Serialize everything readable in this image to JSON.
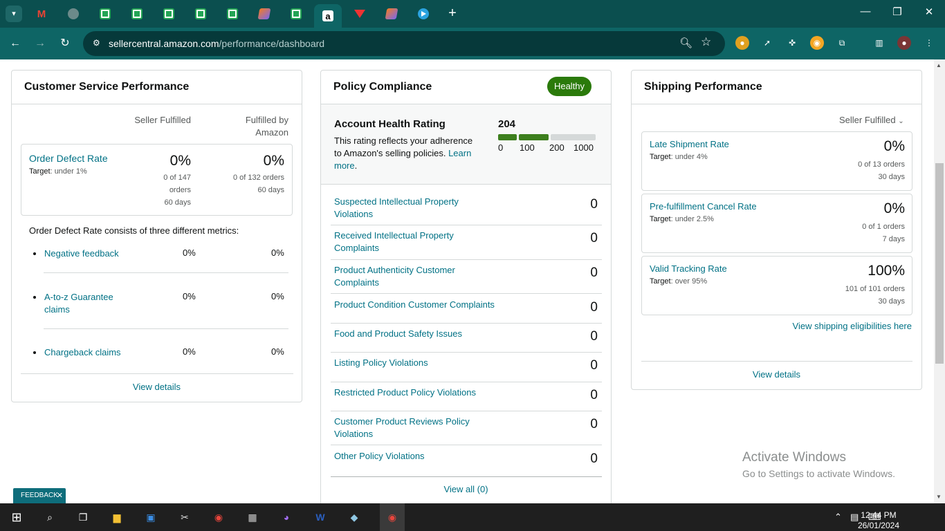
{
  "browser": {
    "url_domain": "sellercentral.amazon.com",
    "url_path": "/performance/dashboard",
    "tabs": [
      {
        "icon": "gmail-icon"
      },
      {
        "icon": "globe-icon"
      },
      {
        "icon": "sheets-icon"
      },
      {
        "icon": "sheets-icon"
      },
      {
        "icon": "sheets-icon"
      },
      {
        "icon": "sheets-icon"
      },
      {
        "icon": "sheets-icon"
      },
      {
        "icon": "clickup-icon"
      },
      {
        "icon": "sheets-icon"
      },
      {
        "icon": "amazon-icon",
        "active": true
      },
      {
        "icon": "red-icon"
      },
      {
        "icon": "clickup-icon"
      },
      {
        "icon": "telegram-icon"
      }
    ]
  },
  "csp": {
    "title": "Customer Service Performance",
    "col_seller": "Seller Fulfilled",
    "col_fba_1": "Fulfilled by",
    "col_fba_2": "Amazon",
    "odr": {
      "title": "Order Defect Rate",
      "target_label": "Target",
      "target_value": ": under 1%",
      "seller_pct": "0%",
      "seller_sub1": "0 of 147",
      "seller_sub2": "orders",
      "seller_sub3": "60 days",
      "fba_pct": "0%",
      "fba_sub1": "0 of 132 orders",
      "fba_sub2": "60 days"
    },
    "description": "Order Defect Rate consists of three different metrics:",
    "metrics": [
      {
        "name": "Negative feedback",
        "seller": "0%",
        "fba": "0%"
      },
      {
        "name": "A-to-z Guarantee claims",
        "seller": "0%",
        "fba": "0%"
      },
      {
        "name": "Chargeback claims",
        "seller": "0%",
        "fba": "0%"
      }
    ],
    "view_details": "View details"
  },
  "policy": {
    "title": "Policy Compliance",
    "badge": "Healthy",
    "ahr_title": "Account Health Rating",
    "ahr_desc": "This rating reflects your adherence to Amazon's selling policies.",
    "ahr_learn": "Learn more",
    "ahr_score": "204",
    "ahr_ticks": [
      "0",
      "100",
      "200",
      "1000"
    ],
    "rows": [
      {
        "name": "Suspected Intellectual Property Violations",
        "value": "0"
      },
      {
        "name": "Received Intellectual Property Complaints",
        "value": "0"
      },
      {
        "name": "Product Authenticity Customer Complaints",
        "value": "0"
      },
      {
        "name": "Product Condition Customer Complaints",
        "value": "0"
      },
      {
        "name": "Food and Product Safety Issues",
        "value": "0"
      },
      {
        "name": "Listing Policy Violations",
        "value": "0"
      },
      {
        "name": "Restricted Product Policy Violations",
        "value": "0"
      },
      {
        "name": "Customer Product Reviews Policy Violations",
        "value": "0"
      },
      {
        "name": "Other Policy Violations",
        "value": "0"
      }
    ],
    "view_all": "View all (0)"
  },
  "shipping": {
    "title": "Shipping Performance",
    "dropdown": "Seller Fulfilled",
    "metrics": [
      {
        "name": "Late Shipment Rate",
        "target_label": "Target",
        "target_value": ": under 4%",
        "pct": "0%",
        "sub1": "0 of 13 orders",
        "sub2": "30 days"
      },
      {
        "name": "Pre-fulfillment Cancel Rate",
        "target_label": "Target",
        "target_value": ": under 2.5%",
        "pct": "0%",
        "sub1": "0 of 1 orders",
        "sub2": "7 days"
      },
      {
        "name": "Valid Tracking Rate",
        "target_label": "Target",
        "target_value": ": over 95%",
        "pct": "100%",
        "sub1": "101 of 101 orders",
        "sub2": "30 days"
      }
    ],
    "eligibility_link": "View shipping eligibilities here",
    "view_details": "View details"
  },
  "watermark": {
    "line1": "Activate Windows",
    "line2": "Go to Settings to activate Windows."
  },
  "feedback": {
    "label": "FEEDBACK",
    "close": "✕"
  },
  "taskbar": {
    "time": "12:44 PM",
    "date": "26/01/2024"
  }
}
